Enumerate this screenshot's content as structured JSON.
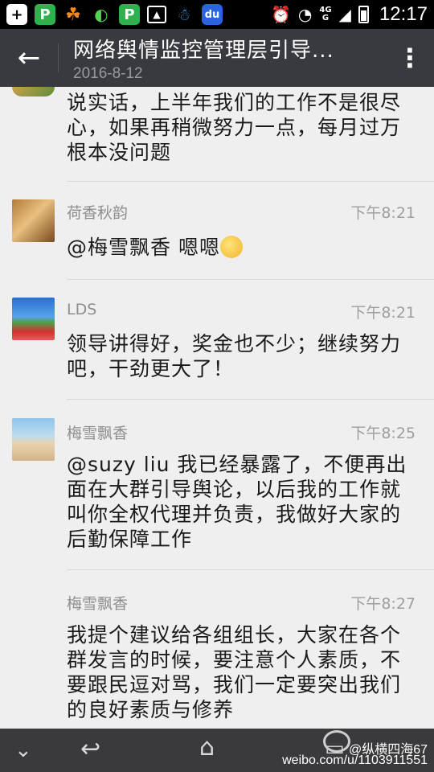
{
  "status_bar": {
    "time": "12:17",
    "network": "4G",
    "network_sub": "G",
    "icons": [
      "plus-box-icon",
      "p-app-icon",
      "uc-browser-icon",
      "wechat-icon",
      "p-app-icon",
      "gallery-icon",
      "qq-icon",
      "baidu-icon",
      "alarm-icon",
      "wifi-icon",
      "signal-icon",
      "battery-icon"
    ]
  },
  "header": {
    "title": "网络舆情监控管理层引导...",
    "date": "2016-8-12"
  },
  "messages": [
    {
      "sender": "",
      "time": "",
      "text": "说实话，上半年我们的工作不是很尽心，如果再稍微努力一点，每月过万根本没问题"
    },
    {
      "sender": "荷香秋韵",
      "time": "下午8:21",
      "text": "@梅雪飘香 嗯嗯"
    },
    {
      "sender": "LDS",
      "time": "下午8:21",
      "text": "领导讲得好，奖金也不少；继续努力吧，干劲更大了！"
    },
    {
      "sender": "梅雪飘香",
      "time": "下午8:25",
      "text": "@suzy liu 我已经暴露了，不便再出面在大群引导舆论，以后我的工作就叫你全权代理并负责，我做好大家的后勤保障工作"
    },
    {
      "sender": "梅雪飘香",
      "time": "下午8:27",
      "text": "我提个建议给各组组长，大家在各个群发言的时候，要注意个人素质，不要跟民逗对骂，我们一定要突出我们的良好素质与修养"
    }
  ],
  "watermark": {
    "line1": "@纵横四海67",
    "line2": "weibo.com/u/1103911551"
  }
}
